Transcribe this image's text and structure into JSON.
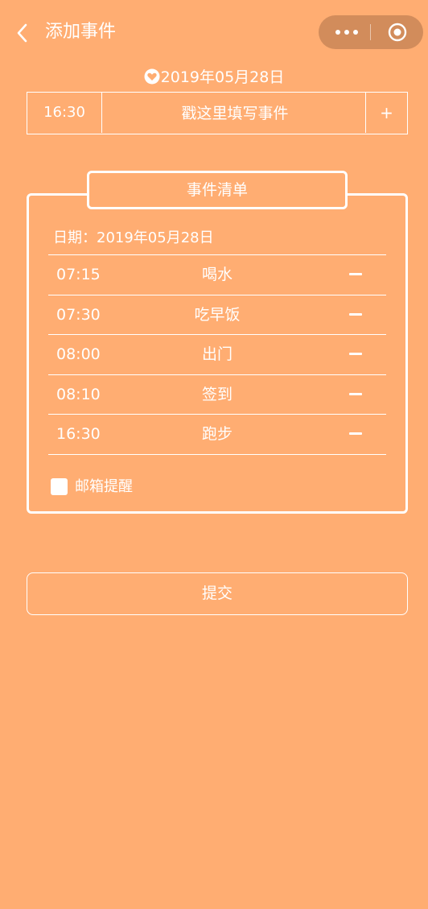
{
  "nav": {
    "title": "添加事件",
    "back_icon": "chevron-left-icon",
    "more_icon": "more-dots-icon",
    "close_icon": "target-circle-icon"
  },
  "date_header": {
    "icon": "heart-icon",
    "text": "2019年05月28日"
  },
  "input_row": {
    "time": "16:30",
    "placeholder": "戳这里填写事件",
    "add_label": "+"
  },
  "list": {
    "title": "事件清单",
    "date_label": "日期：2019年05月28日",
    "items": [
      {
        "time": "07:15",
        "name": "喝水",
        "remove": "remove-icon"
      },
      {
        "time": "07:30",
        "name": "吃早饭",
        "remove": "remove-icon"
      },
      {
        "time": "08:00",
        "name": "出门",
        "remove": "remove-icon"
      },
      {
        "time": "08:10",
        "name": "签到",
        "remove": "remove-icon"
      },
      {
        "time": "16:30",
        "name": "跑步",
        "remove": "remove-icon"
      }
    ],
    "email_label": "邮箱提醒",
    "email_checked": false
  },
  "submit_label": "提交",
  "colors": {
    "background": "#FFAD72",
    "foreground": "#FFFFFF"
  }
}
